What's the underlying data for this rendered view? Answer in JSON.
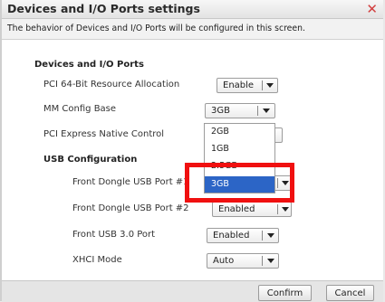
{
  "dialog": {
    "title": "Devices and I/O Ports settings",
    "close_glyph": "✕",
    "description": "The behavior of Devices and I/O Ports will be configured in this screen."
  },
  "sections": {
    "devices": "Devices and I/O Ports",
    "usb": "USB Configuration"
  },
  "settings": {
    "pci64": {
      "label": "PCI 64-Bit Resource Allocation",
      "value": "Enable"
    },
    "mmconfig": {
      "label": "MM Config Base",
      "value": "3GB"
    },
    "pcie": {
      "label": "PCI Express Native Control"
    },
    "dongle1": {
      "label": "Front Dongle USB Port #1"
    },
    "dongle2": {
      "label": "Front Dongle USB Port #2",
      "value": "Enabled"
    },
    "usb3": {
      "label": "Front USB 3.0 Port",
      "value": "Enabled"
    },
    "xhci": {
      "label": "XHCI Mode",
      "value": "Auto"
    }
  },
  "dropdown": {
    "options": [
      "2GB",
      "1GB",
      "2.5GB",
      "3GB"
    ],
    "selected": "3GB"
  },
  "footer": {
    "confirm": "Confirm",
    "cancel": "Cancel"
  },
  "colors": {
    "highlight": "#f01010",
    "selection": "#2c65c6",
    "close": "#d24040"
  }
}
